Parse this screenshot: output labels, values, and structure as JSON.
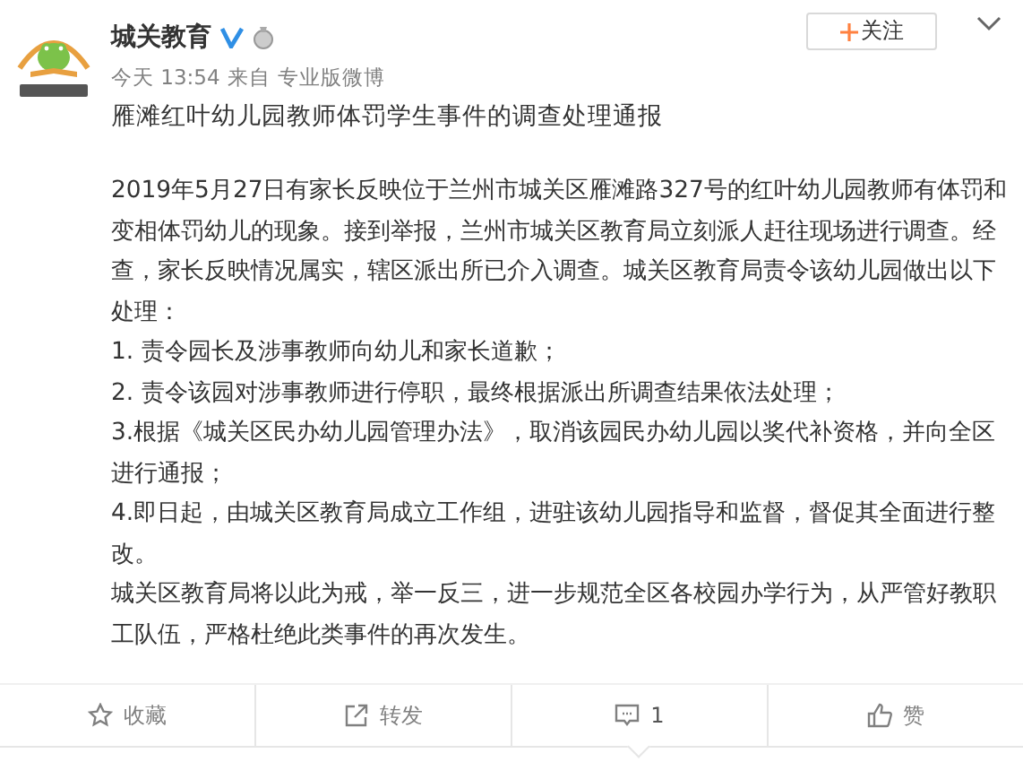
{
  "post": {
    "author": "城关教育",
    "verified": true,
    "time": "今天 13:54",
    "source_prefix": "来自",
    "source": "专业版微博",
    "follow_label": "关注",
    "title": "雁滩红叶幼儿园教师体罚学生事件的调查处理通报",
    "paragraphs": [
      "2019年5月27日有家长反映位于兰州市城关区雁滩路327号的红叶幼儿园教师有体罚和变相体罚幼儿的现象。接到举报，兰州市城关区教育局立刻派人赶往现场进行调查。经查，家长反映情况属实，辖区派出所已介入调查。城关区教育局责令该幼儿园做出以下处理：",
      "1. 责令园长及涉事教师向幼儿和家长道歉；",
      "2. 责令该园对涉事教师进行停职，最终根据派出所调查结果依法处理；",
      "3.根据《城关区民办幼儿园管理办法》，取消该园民办幼儿园以奖代补资格，并向全区进行通报；",
      "4.即日起，由城关区教育局成立工作组，进驻该幼儿园指导和监督，督促其全面进行整改。",
      "城关区教育局将以此为戒，举一反三，进一步规范全区各校园办学行为，从严管好教职工队伍，严格杜绝此类事件的再次发生。"
    ]
  },
  "actions": [
    {
      "kind": "favorite",
      "label": "收藏",
      "selected": false
    },
    {
      "kind": "repost",
      "label": "转发",
      "selected": false
    },
    {
      "kind": "comment",
      "label": "1",
      "selected": true
    },
    {
      "kind": "like",
      "label": "赞",
      "selected": false
    }
  ]
}
